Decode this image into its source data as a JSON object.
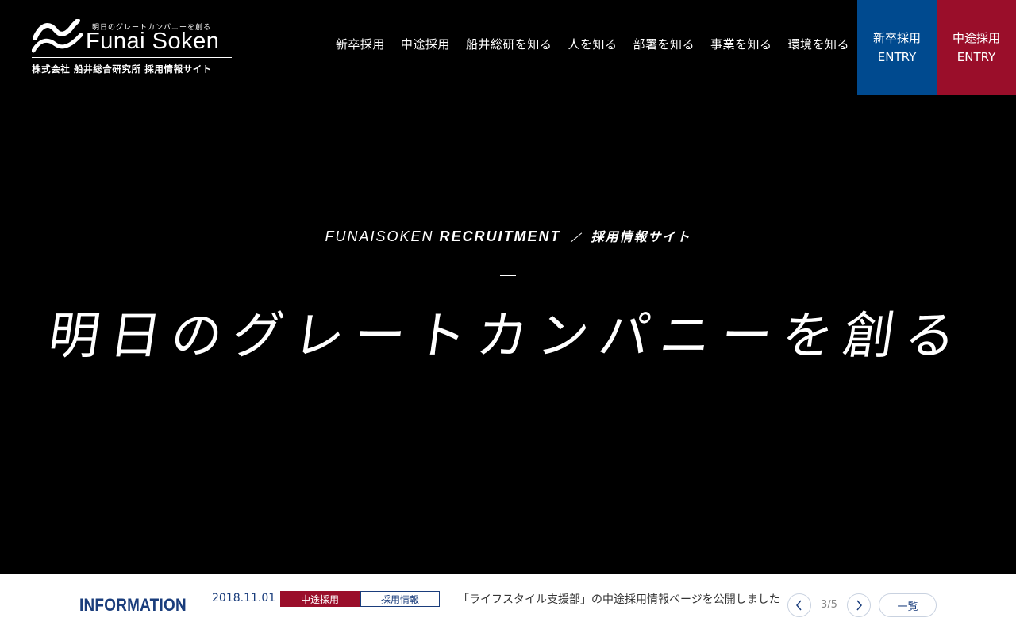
{
  "header": {
    "logo": {
      "tagline": "明日のグレートカンパニーを創る",
      "brand": "Funai Soken",
      "subtitle": "株式会社 船井総合研究所 採用情報サイト"
    },
    "nav": [
      {
        "label": "新卒採用"
      },
      {
        "label": "中途採用"
      },
      {
        "label": "船井総研を知る"
      },
      {
        "label": "人を知る"
      },
      {
        "label": "部署を知る"
      },
      {
        "label": "事業を知る"
      },
      {
        "label": "環境を知る"
      }
    ],
    "entry_new": {
      "line1": "新卒採用",
      "line2": "ENTRY",
      "color": "#004a8f"
    },
    "entry_mid": {
      "line1": "中途採用",
      "line2": "ENTRY",
      "color": "#9a0e2a"
    }
  },
  "hero": {
    "eyebrow_light": "FUNAISOKEN",
    "eyebrow_bold": "RECRUITMENT",
    "eyebrow_site": "採用情報サイト",
    "headline": "明日のグレートカンパニーを創る"
  },
  "info": {
    "label": "INFORMATION",
    "date": "2018.11.01",
    "tag_primary": "中途採用",
    "tag_secondary": "採用情報",
    "text": "「ライフスタイル支援部」の中途採用情報ページを公開しました",
    "counter": "3/5",
    "list_label": "一覧",
    "prev_icon": "chevron-left-icon",
    "next_icon": "chevron-right-icon"
  }
}
